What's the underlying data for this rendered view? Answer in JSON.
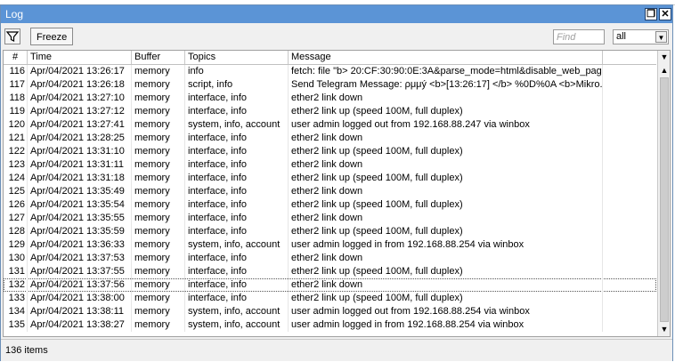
{
  "window": {
    "title": "Log"
  },
  "toolbar": {
    "freeze_label": "Freeze",
    "find_placeholder": "Find",
    "filter_value": "all"
  },
  "columns": {
    "num": "#",
    "time": "Time",
    "buffer": "Buffer",
    "topics": "Topics",
    "message": "Message"
  },
  "rows": [
    {
      "num": "116",
      "time": "Apr/04/2021 13:26:17",
      "buffer": "memory",
      "topics": "info",
      "message": "fetch: file \"b> 20:CF:30:90:0E:3A&parse_mode=html&disable_web_pag..."
    },
    {
      "num": "117",
      "time": "Apr/04/2021 13:26:18",
      "buffer": "memory",
      "topics": "script, info",
      "message": "Send Telegram Message: ρμμý <b>[13:26:17] </b> %0D%0A <b>Mikro..."
    },
    {
      "num": "118",
      "time": "Apr/04/2021 13:27:10",
      "buffer": "memory",
      "topics": "interface, info",
      "message": "ether2 link down"
    },
    {
      "num": "119",
      "time": "Apr/04/2021 13:27:12",
      "buffer": "memory",
      "topics": "interface, info",
      "message": "ether2 link up (speed 100M, full duplex)"
    },
    {
      "num": "120",
      "time": "Apr/04/2021 13:27:41",
      "buffer": "memory",
      "topics": "system, info, account",
      "message": "user admin logged out from 192.168.88.247 via winbox"
    },
    {
      "num": "121",
      "time": "Apr/04/2021 13:28:25",
      "buffer": "memory",
      "topics": "interface, info",
      "message": "ether2 link down"
    },
    {
      "num": "122",
      "time": "Apr/04/2021 13:31:10",
      "buffer": "memory",
      "topics": "interface, info",
      "message": "ether2 link up (speed 100M, full duplex)"
    },
    {
      "num": "123",
      "time": "Apr/04/2021 13:31:11",
      "buffer": "memory",
      "topics": "interface, info",
      "message": "ether2 link down"
    },
    {
      "num": "124",
      "time": "Apr/04/2021 13:31:18",
      "buffer": "memory",
      "topics": "interface, info",
      "message": "ether2 link up (speed 100M, full duplex)"
    },
    {
      "num": "125",
      "time": "Apr/04/2021 13:35:49",
      "buffer": "memory",
      "topics": "interface, info",
      "message": "ether2 link down"
    },
    {
      "num": "126",
      "time": "Apr/04/2021 13:35:54",
      "buffer": "memory",
      "topics": "interface, info",
      "message": "ether2 link up (speed 100M, full duplex)"
    },
    {
      "num": "127",
      "time": "Apr/04/2021 13:35:55",
      "buffer": "memory",
      "topics": "interface, info",
      "message": "ether2 link down"
    },
    {
      "num": "128",
      "time": "Apr/04/2021 13:35:59",
      "buffer": "memory",
      "topics": "interface, info",
      "message": "ether2 link up (speed 100M, full duplex)"
    },
    {
      "num": "129",
      "time": "Apr/04/2021 13:36:33",
      "buffer": "memory",
      "topics": "system, info, account",
      "message": "user admin logged in from 192.168.88.254 via winbox"
    },
    {
      "num": "130",
      "time": "Apr/04/2021 13:37:53",
      "buffer": "memory",
      "topics": "interface, info",
      "message": "ether2 link down"
    },
    {
      "num": "131",
      "time": "Apr/04/2021 13:37:55",
      "buffer": "memory",
      "topics": "interface, info",
      "message": "ether2 link up (speed 100M, full duplex)"
    },
    {
      "num": "132",
      "time": "Apr/04/2021 13:37:56",
      "buffer": "memory",
      "topics": "interface, info",
      "message": "ether2 link down"
    },
    {
      "num": "133",
      "time": "Apr/04/2021 13:38:00",
      "buffer": "memory",
      "topics": "interface, info",
      "message": "ether2 link up (speed 100M, full duplex)"
    },
    {
      "num": "134",
      "time": "Apr/04/2021 13:38:11",
      "buffer": "memory",
      "topics": "system, info, account",
      "message": "user admin logged out from 192.168.88.254 via winbox"
    },
    {
      "num": "135",
      "time": "Apr/04/2021 13:38:27",
      "buffer": "memory",
      "topics": "system, info, account",
      "message": "user admin logged in from 192.168.88.254 via winbox"
    }
  ],
  "selected_row": "132",
  "status": {
    "items": "136 items"
  },
  "colors": {
    "titlebar": "#5b94d6",
    "window_bg": "#f0f0f0"
  },
  "icons": {
    "filter": "filter-funnel-icon",
    "restore": "restore-icon",
    "close": "close-icon"
  }
}
